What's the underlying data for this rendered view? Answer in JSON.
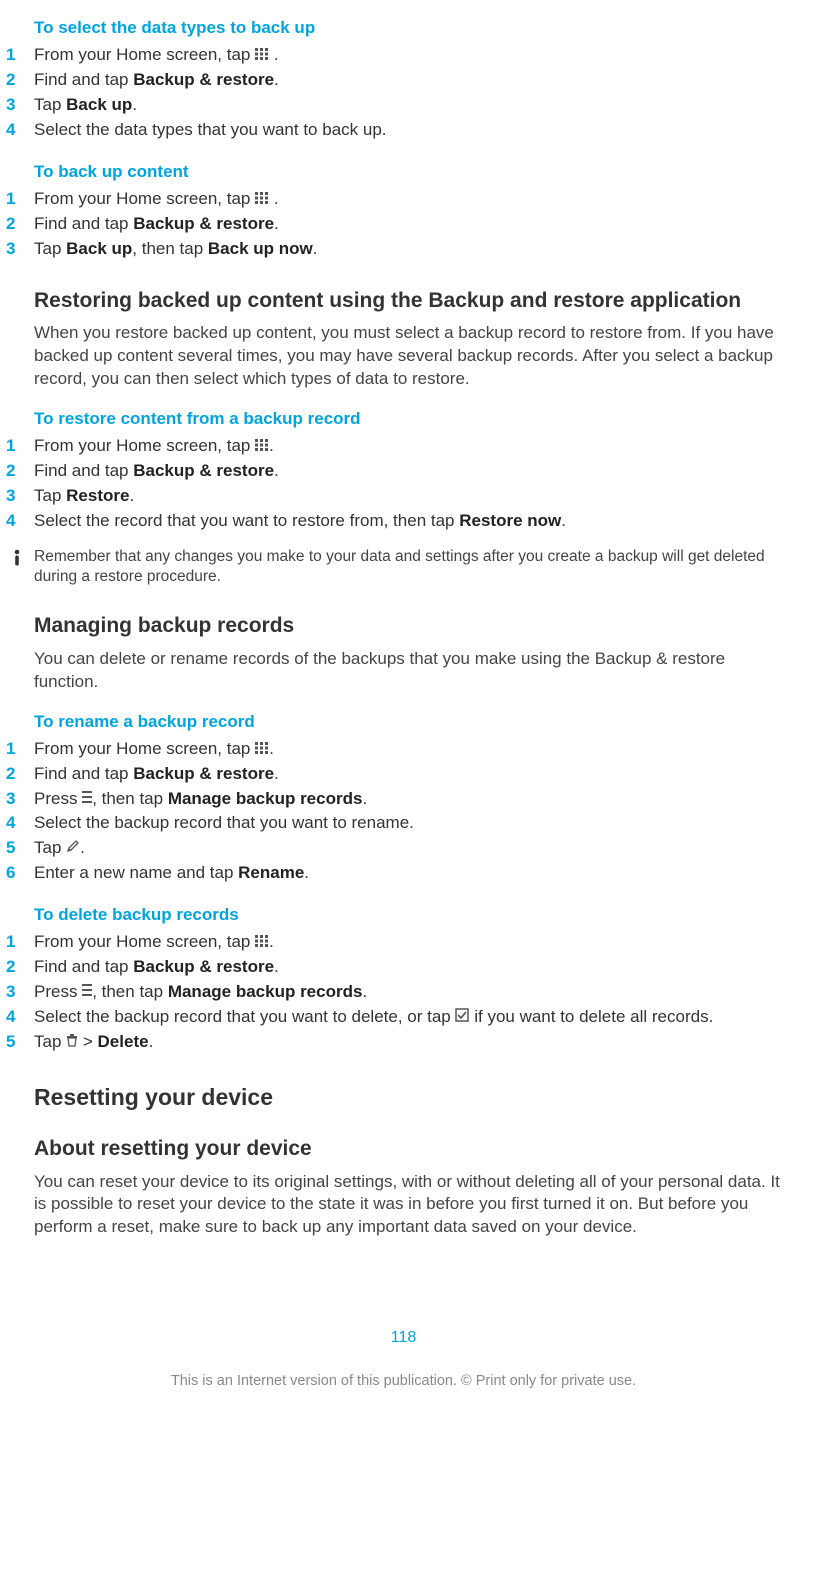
{
  "sections": {
    "selectDataTypes": {
      "heading": "To select the data types to back up",
      "steps": {
        "s1a": "From your Home screen, tap ",
        "s1b": " .",
        "s2a": "Find and tap ",
        "s2b": "Backup & restore",
        "s2c": ".",
        "s3a": "Tap ",
        "s3b": "Back up",
        "s3c": ".",
        "s4": "Select the data types that you want to back up."
      }
    },
    "backUpContent": {
      "heading": "To back up content",
      "steps": {
        "s1a": "From your Home screen, tap ",
        "s1b": " .",
        "s2a": "Find and tap ",
        "s2b": "Backup & restore",
        "s2c": ".",
        "s3a": "Tap ",
        "s3b": "Back up",
        "s3c": ", then tap ",
        "s3d": "Back up now",
        "s3e": "."
      }
    },
    "restoring": {
      "heading": "Restoring backed up content using the Backup and restore application",
      "paragraph": "When you restore backed up content, you must select a backup record to restore from. If you have backed up content several times, you may have several backup records. After you select a backup record, you can then select which types of data to restore."
    },
    "restoreFromRecord": {
      "heading": "To restore content from a backup record",
      "steps": {
        "s1a": "From your Home screen, tap ",
        "s1b": ".",
        "s2a": "Find and tap ",
        "s2b": "Backup & restore",
        "s2c": ".",
        "s3a": "Tap ",
        "s3b": "Restore",
        "s3c": ".",
        "s4a": "Select the record that you want to restore from, then tap ",
        "s4b": "Restore now",
        "s4c": "."
      },
      "note": "Remember that any changes you make to your data and settings after you create a backup will get deleted during a restore procedure."
    },
    "managing": {
      "heading": "Managing backup records",
      "paragraph": "You can delete or rename records of the backups that you make using the Backup & restore function."
    },
    "rename": {
      "heading": "To rename a backup record",
      "steps": {
        "s1a": "From your Home screen, tap ",
        "s1b": ".",
        "s2a": "Find and tap ",
        "s2b": "Backup & restore",
        "s2c": ".",
        "s3a": "Press ",
        "s3b": ", then tap ",
        "s3c": "Manage backup records",
        "s3d": ".",
        "s4": "Select the backup record that you want to rename.",
        "s5a": "Tap ",
        "s5b": ".",
        "s6a": "Enter a new name and tap ",
        "s6b": "Rename",
        "s6c": "."
      }
    },
    "delete": {
      "heading": "To delete backup records",
      "steps": {
        "s1a": "From your Home screen, tap ",
        "s1b": ".",
        "s2a": "Find and tap ",
        "s2b": "Backup & restore",
        "s2c": ".",
        "s3a": "Press ",
        "s3b": ", then tap ",
        "s3c": "Manage backup records",
        "s3d": ".",
        "s4a": "Select the backup record that you want to delete, or tap ",
        "s4b": " if you want to delete all records.",
        "s5a": "Tap ",
        "s5b": " > ",
        "s5c": "Delete",
        "s5d": "."
      }
    },
    "resetting": {
      "heading": "Resetting your device"
    },
    "aboutResetting": {
      "heading": "About resetting your device",
      "paragraph": "You can reset your device to its original settings, with or without deleting all of your personal data. It is possible to reset your device to the state it was in before you first turned it on. But before you perform a reset, make sure to back up any important data saved on your device."
    }
  },
  "noteIcon": "!",
  "pageNumber": "118",
  "footer": "This is an Internet version of this publication. © Print only for private use."
}
